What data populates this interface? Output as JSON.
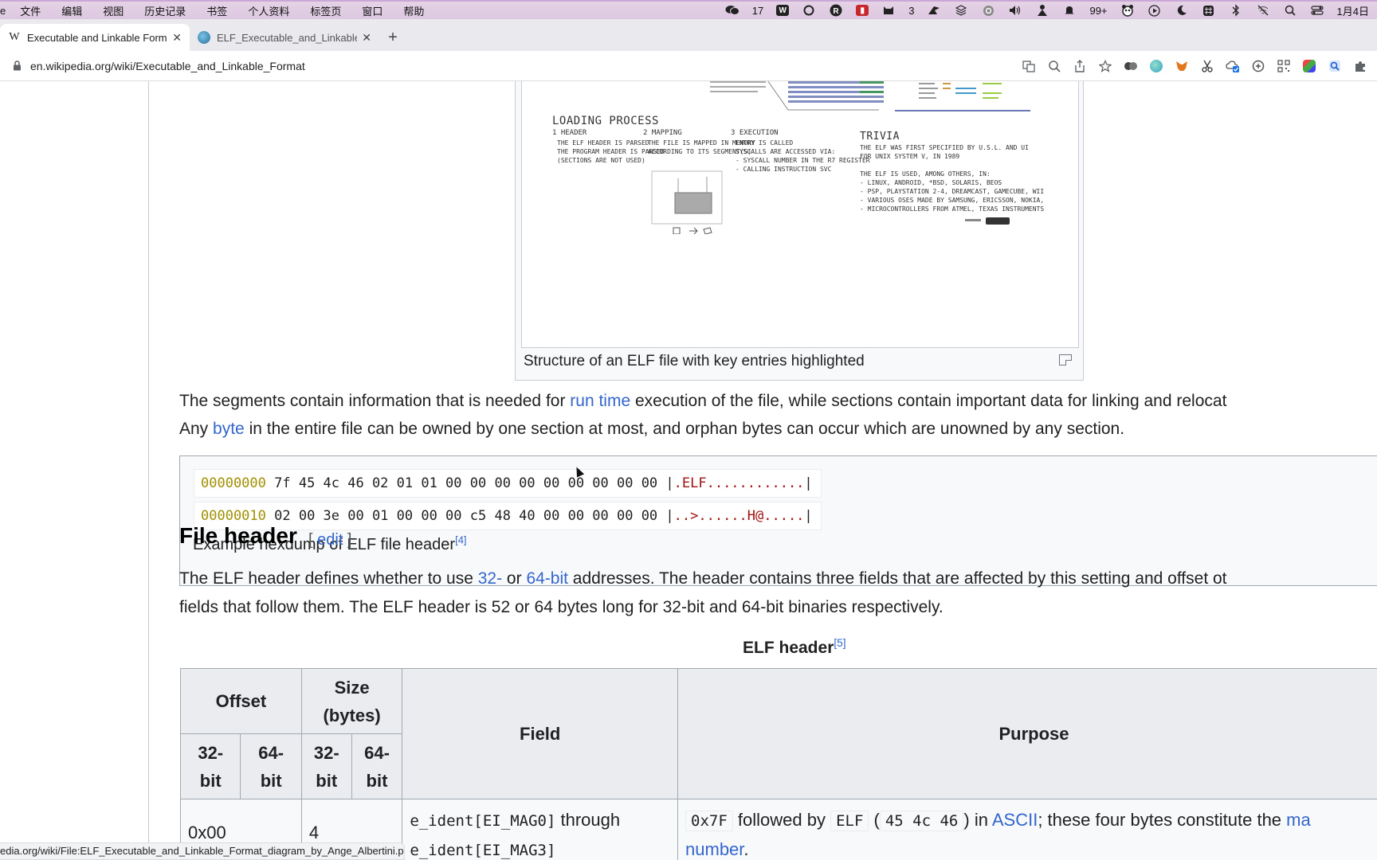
{
  "menubar": {
    "apple_app": "e",
    "items": [
      "文件",
      "编辑",
      "视图",
      "历史记录",
      "书签",
      "个人资料",
      "标签页",
      "窗口",
      "帮助"
    ],
    "wechat_count": "17",
    "notif_a": "3",
    "notif_b": "99+",
    "date": "1月4日"
  },
  "tabs": [
    {
      "title": "Executable and Linkable Forma",
      "favicon": "W",
      "active": true
    },
    {
      "title": "ELF_Executable_and_Linkable",
      "favicon": "globe-icon",
      "active": false
    }
  ],
  "address": {
    "url": "en.wikipedia.org/wiki/Executable_and_Linkable_Format"
  },
  "figure": {
    "caption": "Structure of an ELF file with key entries highlighted",
    "loading_process": "LOADING PROCESS",
    "step1_title": "1 HEADER",
    "step1_text": "THE ELF HEADER IS PARSED\nTHE PROGRAM HEADER IS PARSED\n(SECTIONS ARE NOT USED)",
    "step2_title": "2 MAPPING",
    "step2_text": "THE FILE IS MAPPED IN MEMORY\nACCORDING TO ITS SEGMENT(S)",
    "step3_title": "3 EXECUTION",
    "step3_text": "ENTRY IS CALLED\nSYSCALLS ARE ACCESSED VIA:\n- SYSCALL NUMBER IN THE R7 REGISTER\n- CALLING INSTRUCTION SVC",
    "trivia_title": "TRIVIA",
    "trivia_text": "THE ELF WAS FIRST SPECIFIED BY U.S.L. AND UI\nFOR UNIX SYSTEM V, IN 1989\n\nTHE ELF IS USED, AMONG OTHERS, IN:\n- LINUX, ANDROID, *BSD, SOLARIS, BEOS\n- PSP, PLAYSTATION 2-4, DREAMCAST, GAMECUBE, WII\n- VARIOUS OSES MADE BY SAMSUNG, ERICSSON, NOKIA,\n- MICROCONTROLLERS FROM ATMEL, TEXAS INSTRUMENTS"
  },
  "para1": {
    "l1_a": "The segments contain information that is needed for ",
    "l1_link": "run time",
    "l1_b": " execution of the file, while sections contain important data for linking and relocat",
    "l2_a": "Any ",
    "l2_link": "byte",
    "l2_b": " in the entire file can be owned by one section at most, and orphan bytes can occur which are unowned by any section."
  },
  "hexdump": {
    "rows": [
      {
        "offset": "00000000",
        "bytes": " 7f 45 4c 46 02 01 01 00 00 00 00 00 00 00 00 00 ",
        "sep": "|",
        "ascii": ".ELF............",
        "end": "|"
      },
      {
        "offset": "00000010",
        "bytes": " 02 00 3e 00 01 00 00 00 c5 48 40 00 00 00 00 00 ",
        "sep": "|",
        "ascii": "..>......H@.....",
        "end": "|"
      }
    ],
    "caption": "Example hexdump of ELF file header",
    "caption_ref": "[4]"
  },
  "section": {
    "title": "File header",
    "edit_open": "[ ",
    "edit": "edit",
    "edit_close": " ]"
  },
  "para2": {
    "l1_a": "The ELF header defines whether to use ",
    "l1_link1": "32-",
    "l1_mid": " or ",
    "l1_link2": "64-bit",
    "l1_b": " addresses. The header contains three fields that are affected by this setting and offset ot",
    "l2": "fields that follow them. The ELF header is 52 or 64 bytes long for 32-bit and 64-bit binaries respectively."
  },
  "table": {
    "caption": "ELF header",
    "caption_ref": "[5]",
    "h_offset": "Offset",
    "h_size": "Size (bytes)",
    "h_field": "Field",
    "h_purpose": "Purpose",
    "h_32": "32-bit",
    "h_64": "64-bit",
    "h_32b": "32-bit",
    "h_64b": "64-bit",
    "row1": {
      "offset": "0x00",
      "size": "4",
      "field_a": "e_ident[EI_MAG0]",
      "field_mid": " through",
      "field_b": "e_ident[EI_MAG3]",
      "p_code1": "0x7F",
      "p_t1": " followed by ",
      "p_code2": "ELF",
      "p_t2": " (",
      "p_code3": "45 4c 46",
      "p_t3": ") in ",
      "p_link": "ASCII",
      "p_t4": "; these four bytes constitute the ",
      "p_link2": "ma",
      "p_link3": "number",
      "p_t5": "."
    }
  },
  "statusbar": {
    "text": "edia.org/wiki/File:ELF_Executable_and_Linkable_Format_diagram_by_Ange_Albertini.png"
  }
}
